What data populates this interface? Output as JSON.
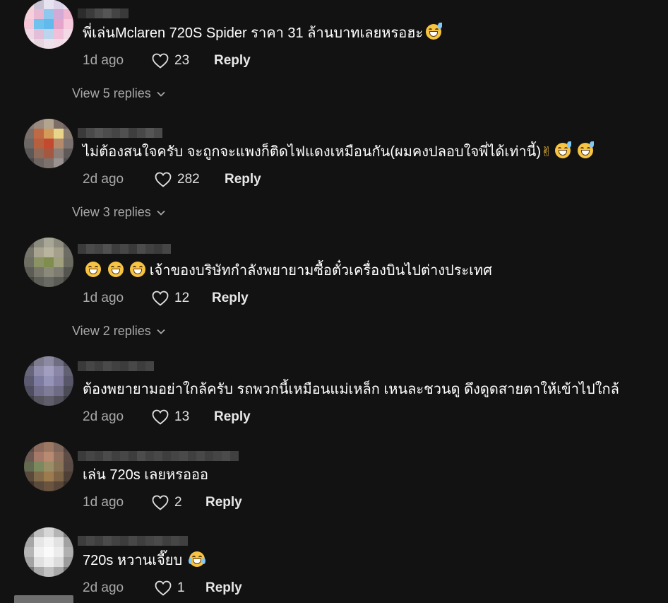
{
  "colors": {
    "background": "#121212",
    "text_primary": "#ffffff",
    "text_secondary": "#a8a8a8"
  },
  "comments": [
    {
      "text": "พี่เล่นMclaren 720S Spider ราคา 31 ล้านบาทเลยหรอฮะ",
      "emojis": [
        "grin-sweat"
      ],
      "time": "1d ago",
      "likes": "23",
      "reply_label": "Reply",
      "view_replies": "View 5 replies"
    },
    {
      "text": "ไม่ต้องสนใจครับ จะถูกจะแพงก็ติดไฟแดงเหมือนกัน(ผมคงปลอบใจพี่ได้เท่านี้)",
      "emojis": [
        "victory-hand",
        "grin-sweat",
        "grin-sweat"
      ],
      "time": "2d ago",
      "likes": "282",
      "reply_label": "Reply",
      "view_replies": "View 3 replies"
    },
    {
      "text": "เจ้าของบริษัทกำลังพยายามซื้อตั๋วเครื่องบินไปต่างประเทศ",
      "emojis_before": [
        "grin",
        "grin",
        "grin"
      ],
      "time": "1d ago",
      "likes": "12",
      "reply_label": "Reply",
      "view_replies": "View 2 replies"
    },
    {
      "text": "ต้องพยายามอย่าใกล้ครับ รถพวกนี้เหมือนแม่เหล็ก เหนละชวนดู ดึงดูดสายตาให้เข้าไปใกล้",
      "time": "2d ago",
      "likes": "13",
      "reply_label": "Reply"
    },
    {
      "text": "เล่น 720s เลยหรอออ",
      "time": "1d ago",
      "likes": "2",
      "reply_label": "Reply"
    },
    {
      "text": "720s หวานเจี๊ยบ",
      "emojis": [
        "tears-of-joy"
      ],
      "time": "2d ago",
      "likes": "1",
      "reply_label": "Reply"
    }
  ]
}
